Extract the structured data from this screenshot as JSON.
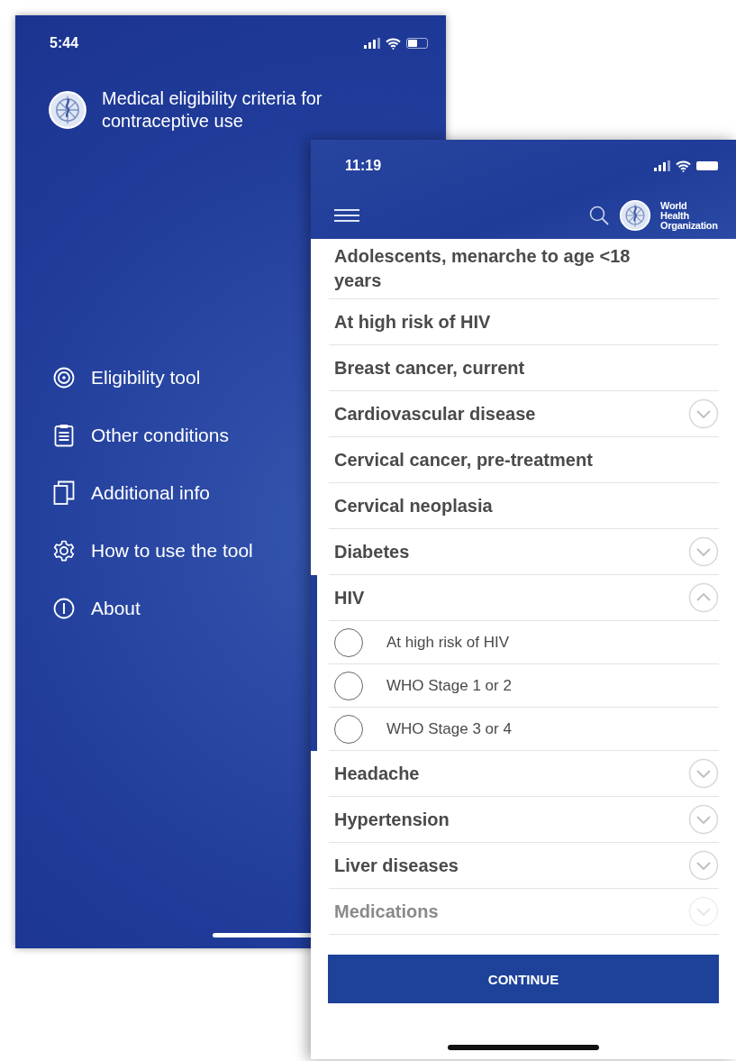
{
  "menu_screen": {
    "status_bar": {
      "time": "5:44"
    },
    "title": "Medical eligibility criteria for contraceptive use",
    "menu_items": [
      {
        "kind": "target",
        "label": "Eligibility tool"
      },
      {
        "kind": "clipboard",
        "label": "Other conditions"
      },
      {
        "kind": "pages",
        "label": "Additional info"
      },
      {
        "kind": "gear",
        "label": "How to use the tool"
      },
      {
        "kind": "info",
        "label": "About"
      }
    ]
  },
  "conditions_screen": {
    "status_bar": {
      "time": "11:19"
    },
    "logo_text": "World Health Organization",
    "conditions": [
      {
        "label": "Adolescents, menarche to age <18 years",
        "expandable": false,
        "faded": false
      },
      {
        "label": "At high risk of HIV",
        "expandable": false,
        "faded": false
      },
      {
        "label": "Breast cancer, current",
        "expandable": false,
        "faded": false
      },
      {
        "label": "Cardiovascular disease",
        "expandable": true,
        "expanded": false,
        "faded": false
      },
      {
        "label": "Cervical cancer, pre-treatment",
        "expandable": false,
        "faded": false
      },
      {
        "label": "Cervical neoplasia",
        "expandable": false,
        "faded": false
      },
      {
        "label": "Diabetes",
        "expandable": true,
        "expanded": false,
        "faded": false
      },
      {
        "label": "HIV",
        "expandable": true,
        "expanded": true,
        "faded": false,
        "children": [
          {
            "label": "At high risk of HIV",
            "checked": false
          },
          {
            "label": "WHO Stage 1 or 2",
            "checked": false
          },
          {
            "label": "WHO Stage 3 or 4",
            "checked": false
          }
        ]
      },
      {
        "label": "Headache",
        "expandable": true,
        "expanded": false,
        "faded": false
      },
      {
        "label": "Hypertension",
        "expandable": true,
        "expanded": false,
        "faded": false
      },
      {
        "label": "Liver diseases",
        "expandable": true,
        "expanded": false,
        "faded": false
      },
      {
        "label": "Medications",
        "expandable": true,
        "expanded": false,
        "faded": true
      }
    ],
    "button": "CONTINUE"
  }
}
